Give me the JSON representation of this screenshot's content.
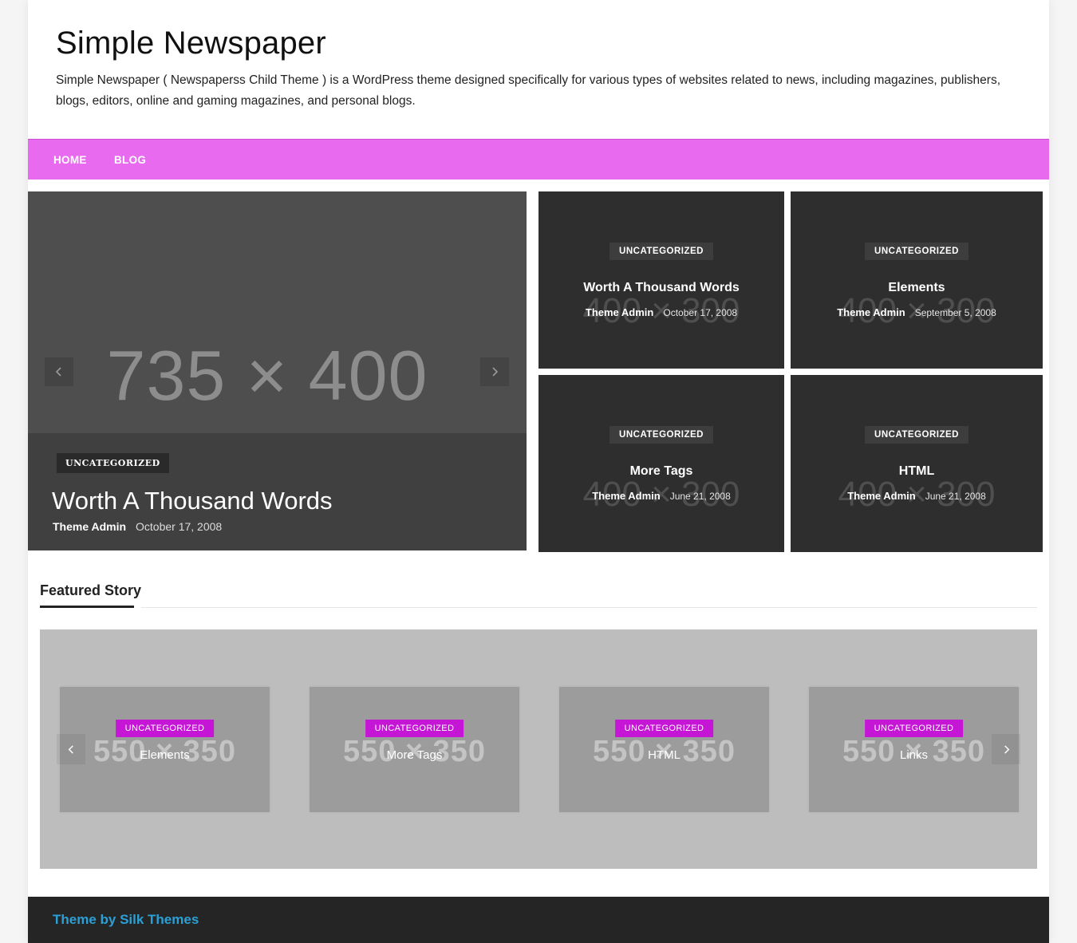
{
  "header": {
    "site_title": "Simple Newspaper",
    "site_description": "Simple Newspaper ( Newspaperss Child Theme ) is a WordPress theme designed specifically for various types of websites related to news, including magazines, publishers, blogs, editors, online and gaming magazines, and personal blogs."
  },
  "nav": {
    "items": [
      {
        "label": "HOME"
      },
      {
        "label": "BLOG"
      }
    ]
  },
  "slider": {
    "placeholder": "735 × 400",
    "category": "UNCATEGORIZED",
    "title": "Worth A Thousand Words",
    "author": "Theme Admin",
    "date": "October 17, 2008",
    "prev_icon": "chevron-left-icon",
    "next_icon": "chevron-right-icon"
  },
  "grid": [
    {
      "placeholder": "400 × 300",
      "category": "UNCATEGORIZED",
      "title": "Worth A Thousand Words",
      "author": "Theme Admin",
      "date": "October 17, 2008"
    },
    {
      "placeholder": "400 × 300",
      "category": "UNCATEGORIZED",
      "title": "Elements",
      "author": "Theme Admin",
      "date": "September 5, 2008"
    },
    {
      "placeholder": "400 × 300",
      "category": "UNCATEGORIZED",
      "title": "More Tags",
      "author": "Theme Admin",
      "date": "June 21, 2008"
    },
    {
      "placeholder": "400 × 300",
      "category": "UNCATEGORIZED",
      "title": "HTML",
      "author": "Theme Admin",
      "date": "June 21, 2008"
    }
  ],
  "featured": {
    "heading": "Featured Story",
    "cards": [
      {
        "placeholder": "550 × 350",
        "category": "UNCATEGORIZED",
        "title": "Elements"
      },
      {
        "placeholder": "550 × 350",
        "category": "UNCATEGORIZED",
        "title": "More Tags"
      },
      {
        "placeholder": "550 × 350",
        "category": "UNCATEGORIZED",
        "title": "HTML"
      },
      {
        "placeholder": "550 × 350",
        "category": "UNCATEGORIZED",
        "title": "Links"
      }
    ]
  },
  "footer": {
    "credit": "Theme by Silk Themes"
  },
  "colors": {
    "nav_bg": "#e86bef",
    "category_badge": "#c516d6",
    "footer_bg": "#252525",
    "footer_link": "#2ba0d6"
  }
}
